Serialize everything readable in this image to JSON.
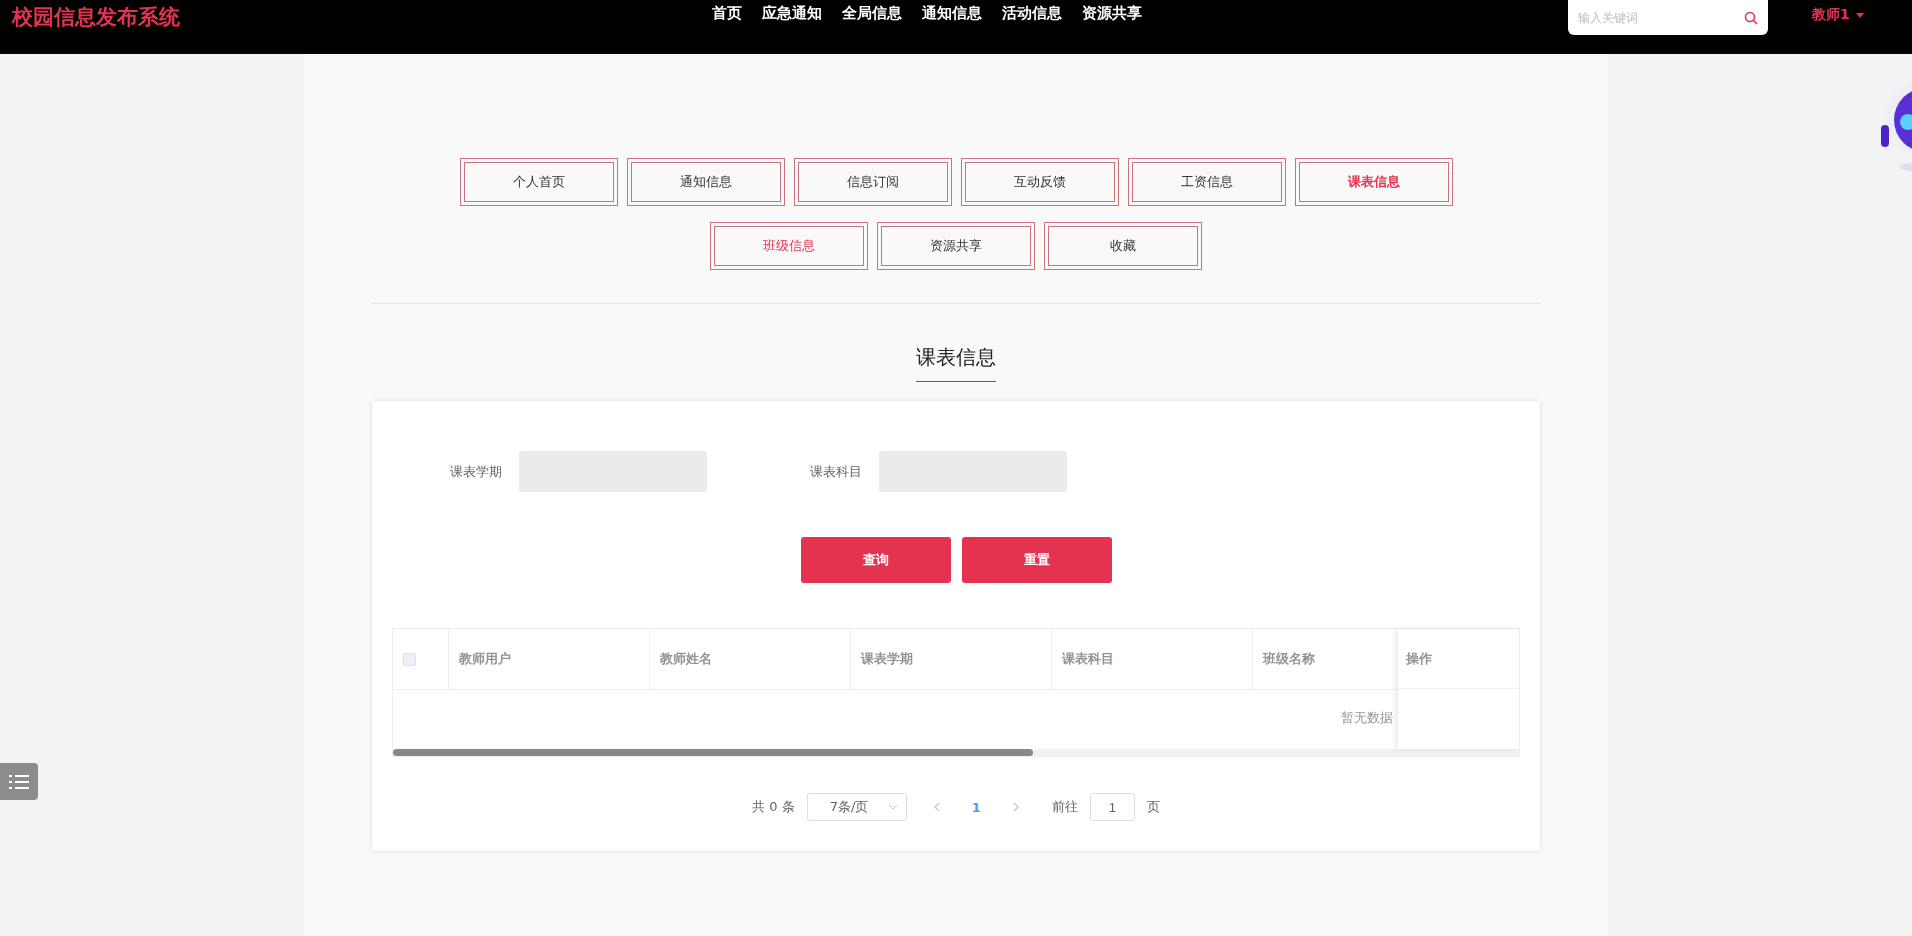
{
  "header": {
    "logo": "校园信息发布系统",
    "nav": [
      "首页",
      "应急通知",
      "全局信息",
      "通知信息",
      "活动信息",
      "资源共享"
    ],
    "search": {
      "placeholder": "输入关键词"
    },
    "user": "教师1"
  },
  "tabs": [
    {
      "label": "个人首页",
      "selected": false,
      "hovered": false
    },
    {
      "label": "通知信息",
      "selected": false,
      "hovered": false
    },
    {
      "label": "信息订阅",
      "selected": false,
      "hovered": false
    },
    {
      "label": "互动反馈",
      "selected": false,
      "hovered": false
    },
    {
      "label": "工资信息",
      "selected": false,
      "hovered": false
    },
    {
      "label": "课表信息",
      "selected": true,
      "hovered": false
    },
    {
      "label": "班级信息",
      "selected": false,
      "hovered": true
    },
    {
      "label": "资源共享",
      "selected": false,
      "hovered": false
    },
    {
      "label": "收藏",
      "selected": false,
      "hovered": false
    }
  ],
  "section_title": "课表信息",
  "filters": [
    {
      "label": "课表学期"
    },
    {
      "label": "课表科目"
    }
  ],
  "buttons": [
    "查询",
    "重置"
  ],
  "table": {
    "select_all": {
      "checked": false
    },
    "columns": [
      "教师用户",
      "教师姓名",
      "课表学期",
      "课表科目",
      "班级名称"
    ],
    "action_column": "操作",
    "empty_text": "暂无数据"
  },
  "pagination": {
    "total": "共 0 条",
    "page_size": "7条/页",
    "current_page": "1",
    "goto_label": "前往",
    "goto_value": "1",
    "page_suffix": "页"
  }
}
